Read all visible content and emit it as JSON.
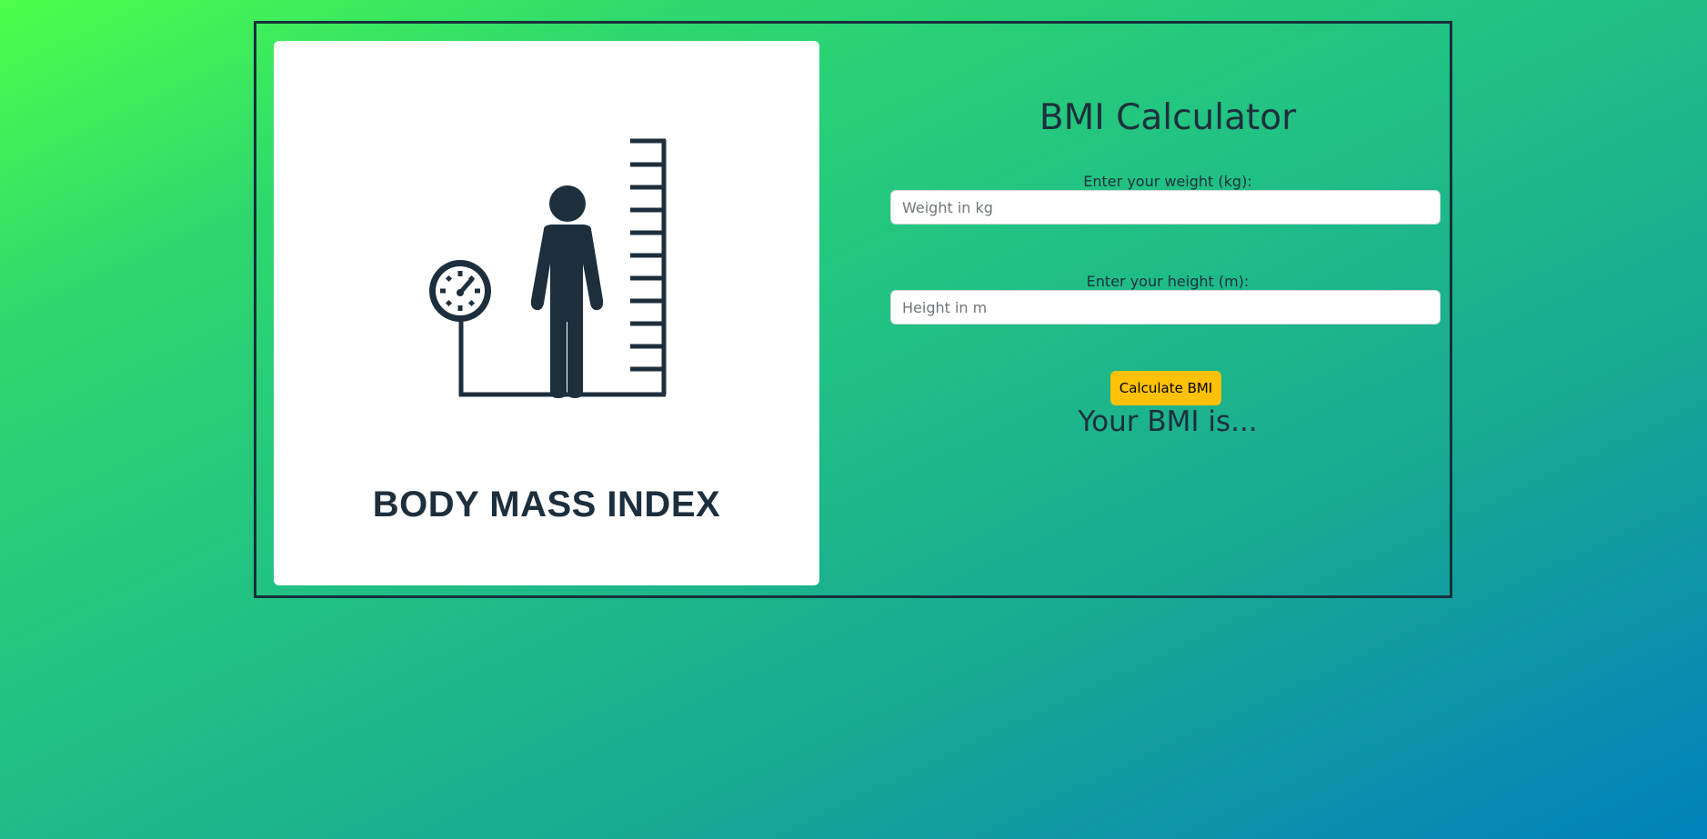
{
  "illustration": {
    "caption": "BODY MASS INDEX",
    "icons": [
      "person-icon",
      "scale-gauge-icon",
      "height-ruler-icon"
    ]
  },
  "form": {
    "title": "BMI Calculator",
    "weight": {
      "label": "Enter your weight (kg):",
      "placeholder": "Weight in kg",
      "value": ""
    },
    "height": {
      "label": "Enter your height (m):",
      "placeholder": "Height in m",
      "value": ""
    },
    "calculate_label": "Calculate BMI",
    "result_text": "Your BMI is..."
  },
  "colors": {
    "ink": "#1d2f3d",
    "button": "#ffc107",
    "card": "#ffffff",
    "gradient_start": "#4cff4a",
    "gradient_end": "#0082bb"
  }
}
